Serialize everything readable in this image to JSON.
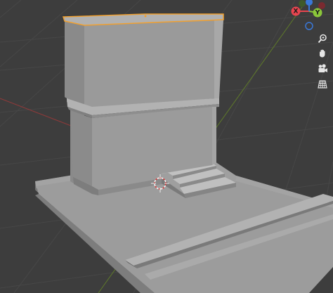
{
  "viewport": {
    "background_color": "#3d3d3d",
    "grid_line_color": "#474747",
    "x_axis_color": "#8a3a3a",
    "y_axis_color": "#6a8a2a",
    "selection_outline_color": "#f0a030"
  },
  "gizmo": {
    "x_label": "X",
    "y_label": "Y",
    "z_label": "",
    "x_color": "#e8454f",
    "y_color": "#8bc73a",
    "z_color": "#3a78d8",
    "neg_z_color": "#3d5d92"
  },
  "nav_tools": [
    {
      "id": "zoom",
      "icon": "magnifier-icon"
    },
    {
      "id": "pan",
      "icon": "hand-icon"
    },
    {
      "id": "camera",
      "icon": "camera-icon"
    },
    {
      "id": "perspective",
      "icon": "grid-icon"
    }
  ]
}
